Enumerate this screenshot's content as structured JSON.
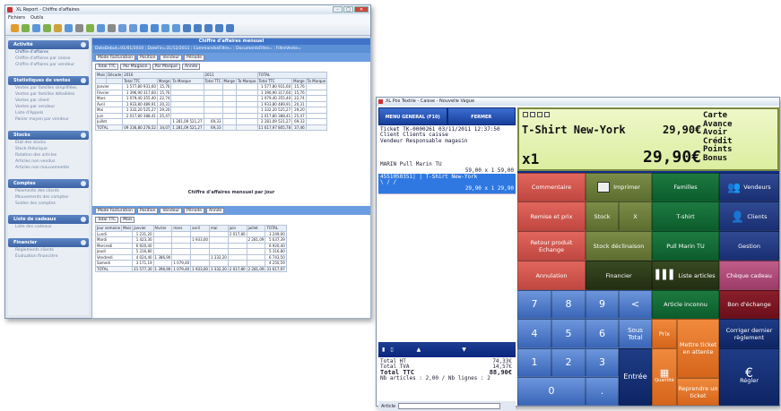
{
  "win1": {
    "title": "XL Report - Chiffre d'affaires",
    "menu": [
      "Fichiers",
      "Outils"
    ],
    "side": [
      {
        "title": "Activité",
        "items": [
          "Chiffre d'affaires",
          "Chiffre d'affaires par caisse",
          "Chiffre d'affaires par vendeur"
        ]
      },
      {
        "title": "Statistiques de ventes",
        "items": [
          "Ventes par familles simplifiées",
          "Ventes par familles détaillées",
          "Ventes par client",
          "Ventes par vendeur",
          "Liste d'Appels",
          "Panier moyen par vendeur"
        ]
      },
      {
        "title": "Stocks",
        "items": [
          "État des stocks",
          "Stock théorique",
          "Rotation des articles",
          "Articles non vendus",
          "Articles non mouvementés"
        ]
      },
      {
        "title": "Comptes",
        "items": [
          "Paiements des clients",
          "Mouvements des comptes",
          "Soldes des comptes"
        ]
      },
      {
        "title": "Liste de cadeaux",
        "items": [
          "Liste des cadeaux"
        ]
      },
      {
        "title": "Financier",
        "items": [
          "Règlements clients",
          "Évaluation financière"
        ]
      }
    ],
    "p1title": "Chiffre d'affaires mensuel",
    "p1filter": "DateDebut=01/01/2010 ; DateFin=31/12/2011 ; CommandesFiltre= ; DocumentsFiltre= ; FiltreVente=",
    "filters": [
      "Mode Facturation",
      "Position",
      "Vendeur",
      "Période"
    ],
    "filters2": [
      "Total TTC",
      "Par Magasin",
      "Par Marque",
      "Année"
    ],
    "rowfields": [
      "Mois",
      "Décade"
    ],
    "years": [
      "2010",
      "2011",
      "TOTAL"
    ],
    "cols": [
      "Total TTC",
      "Marge",
      "Ta Marque",
      "Total TTC",
      "Marge",
      "Ta Marque",
      "Total TTC",
      "Marge",
      "Ta Marque"
    ],
    "rows": [
      [
        "Janvier",
        "1 577,80 931,60",
        "15,76",
        "",
        "",
        "",
        "",
        "1 577,80 931,60",
        "15,76"
      ],
      [
        "Février",
        "1 396,90 317,60",
        "15,76",
        "",
        "",
        "",
        "",
        "1 396,90 317,60",
        "15,76"
      ],
      [
        "Mars",
        "1 079,40 355,40",
        "22,74",
        "",
        "",
        "",
        "",
        "1 079,40 355,40",
        "22,74"
      ],
      [
        "Avril",
        "1 933,80 489,91",
        "20,31",
        "",
        "",
        "",
        "",
        "1 933,80 489,91",
        "20,31"
      ],
      [
        "Mai",
        "1 332,20 525,27",
        "29,20",
        "",
        "",
        "",
        "",
        "1 332,20 525,27",
        "29,20"
      ],
      [
        "Juin",
        "2 017,80 388,41",
        "25,47",
        "",
        "",
        "",
        "",
        "2 017,80 388,41",
        "25,47"
      ],
      [
        "Juillet",
        "",
        "",
        "1 281,09 521,27",
        "69,33",
        "",
        "",
        "2 281,09 521,27",
        "69,33"
      ],
      [
        "TOTAL",
        "09 336,80 278,52",
        "34,07",
        "1 281,09 521,27",
        "69,33",
        "",
        "",
        "11 617,97 805,78",
        "37,46"
      ]
    ],
    "p2title": "Chiffre d'affaires mensuel par jour",
    "filters3": [
      "Mode Facturation",
      "Position",
      "Vendeur",
      "Période",
      "Année"
    ],
    "filters4": [
      "Total TTC",
      "Mois"
    ],
    "p2rowfields": [
      "Jour semaine",
      "Mois"
    ],
    "p2cols": [
      "janvier",
      "février",
      "mars",
      "avril",
      "mai",
      "juin",
      "juillet",
      "TOTAL"
    ],
    "p2rows": [
      [
        "Lundi",
        "1 231,20",
        "",
        "",
        "",
        "",
        "2 017,80",
        "",
        "3 249,00"
      ],
      [
        "Mardi",
        "1 423,30",
        "",
        "",
        "1 933,00",
        "",
        "",
        "2 281,09",
        "5 637,39"
      ],
      [
        "Mercredi",
        "6 920,40",
        "",
        "",
        "",
        "",
        "",
        "",
        "6 920,40"
      ],
      [
        "Jeudi",
        "5 316,80",
        "",
        "",
        "",
        "",
        "",
        "",
        "5 316,80"
      ],
      [
        "Vendredi",
        "4 024,40",
        "1 386,90",
        "",
        "",
        "1 332,20",
        "",
        "",
        "6 743,50"
      ],
      [
        "Samedi",
        "3 171,19",
        "",
        "1 079,40",
        "",
        "",
        "",
        "",
        "4 250,59"
      ],
      [
        "TOTAL",
        "21 577,30",
        "1 396,90",
        "1 079,40",
        "1 933,00",
        "1 332,20",
        "2 017,80",
        "2 281,09",
        "31 617,97"
      ]
    ]
  },
  "win2": {
    "title": "XL Pos Textile - Caisse - Nouvelle Vague",
    "menu_btn": "MENU GENERAL (F10)",
    "close_btn": "FERMER",
    "ticket_lines": [
      "Ticket   TK-0000261  03/11/2011 12:37:50",
      "Client Clients caisse",
      "Vendeur Responsable magasin"
    ],
    "item1": "MARIN Pull Marin TU",
    "item1_qty": "59,00 x 1      59,00",
    "item2_code": "4551050351|     | T-Shirt New-York",
    "item2_mark": "\\  /  /",
    "item2_qty": "29,90 x 1      29,90",
    "tot_ht_l": "Total HT",
    "tot_ht": "74,33€",
    "tot_tva_l": "Total TVA",
    "tot_tva": "14,57€",
    "tot_ttc_l": "Total TTC",
    "tot_ttc": "88,90€",
    "nb": "Nb articles : 2,00 / Nb lignes : 2",
    "article_l": "Article",
    "lcd_name": "T-Shirt New-York",
    "lcd_p1": "29,90€",
    "lcd_qty": "x1",
    "lcd_p2": "29,90€",
    "lcd_opts": [
      "Carte",
      "Avance",
      "Avoir",
      "Crédit",
      "Points",
      "Bonus"
    ],
    "b": {
      "commentaire": "Commentaire",
      "imprimer": "Imprimer",
      "familles": "Familles",
      "vendeurs": "Vendeurs",
      "remise": "Remise et prix",
      "stock": "Stock",
      "x": "X",
      "tshirt": "T-shirt",
      "clients": "Clients",
      "retour": "Retour produit Echange",
      "stockdecl": "Stock déclinaison",
      "pull": "Pull Marin TU",
      "gestion": "Gestion",
      "annulation": "Annulation",
      "financier": "Financier",
      "liste": "Liste articles",
      "cheque": "Chèque cadeau",
      "n7": "7",
      "n8": "8",
      "n9": "9",
      "back": "<",
      "inconnu": "Article inconnu",
      "bon": "Bon d'échange",
      "n4": "4",
      "n5": "5",
      "n6": "6",
      "sous": "Sous Total",
      "prix": "Prix",
      "mettre": "Mettre ticket en attente",
      "corriger": "Corriger dernier règlement",
      "n1": "1",
      "n2": "2",
      "n3": "3",
      "entree": "Entrée",
      "quantite": "Quantité",
      "reprendre": "Reprendre un ticket",
      "regler": "Régler",
      "n0": "0",
      "dot": "."
    }
  }
}
